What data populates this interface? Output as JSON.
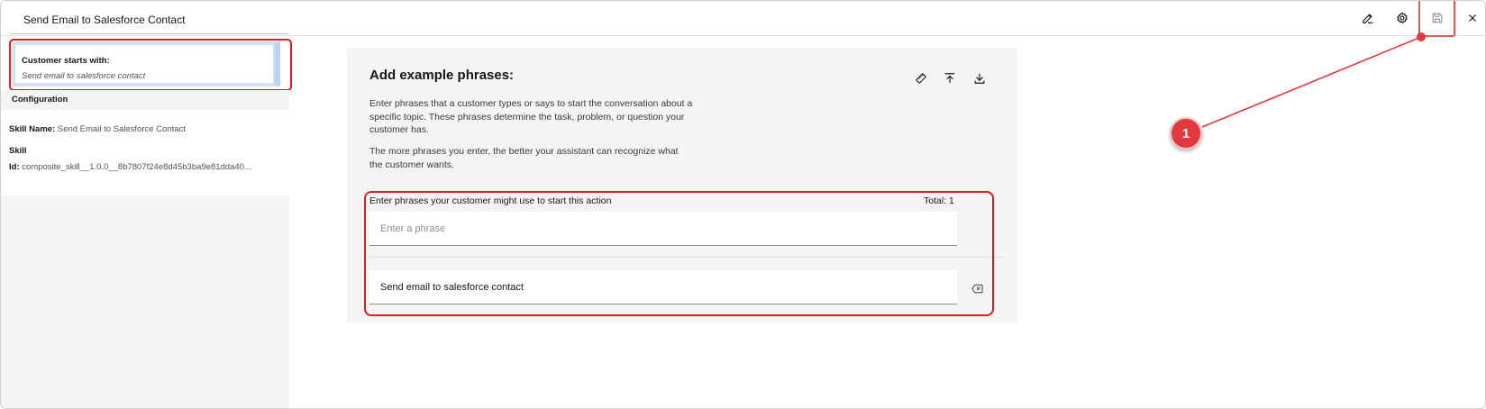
{
  "header": {
    "title": "Send Email to Salesforce Contact",
    "icons": [
      "edit-icon",
      "gear-icon",
      "save-icon",
      "close-icon"
    ]
  },
  "sidebar": {
    "starts_label": "Customer starts with:",
    "starts_value": "Send email to salesforce contact",
    "config_heading": "Configuration",
    "skill_name_key": "Skill Name:",
    "skill_name_value": "Send Email to Salesforce Contact",
    "skill_key_1": "Skill",
    "skill_id_key": "Id:",
    "skill_id_value": "composite_skill__1.0.0__8b7807f24e8d45b3ba9e81dda40..."
  },
  "main": {
    "title": "Add example phrases:",
    "description_1": "Enter phrases that a customer types or says to start the conversation about a specific topic. These phrases determine the task, problem, or question your customer has.",
    "description_2": "The more phrases you enter, the better your assistant can recognize what the customer wants.",
    "phrases_label": "Enter phrases your customer might use to start this action",
    "total_label": "Total: 1",
    "input_placeholder": "Enter a phrase",
    "phrases": [
      "Send email to salesforce contact"
    ]
  },
  "annotation": {
    "badge": "1"
  },
  "colors": {
    "highlight": "#da1e28",
    "badge": "#e03a3e",
    "panel_bg": "#f4f4f4"
  }
}
